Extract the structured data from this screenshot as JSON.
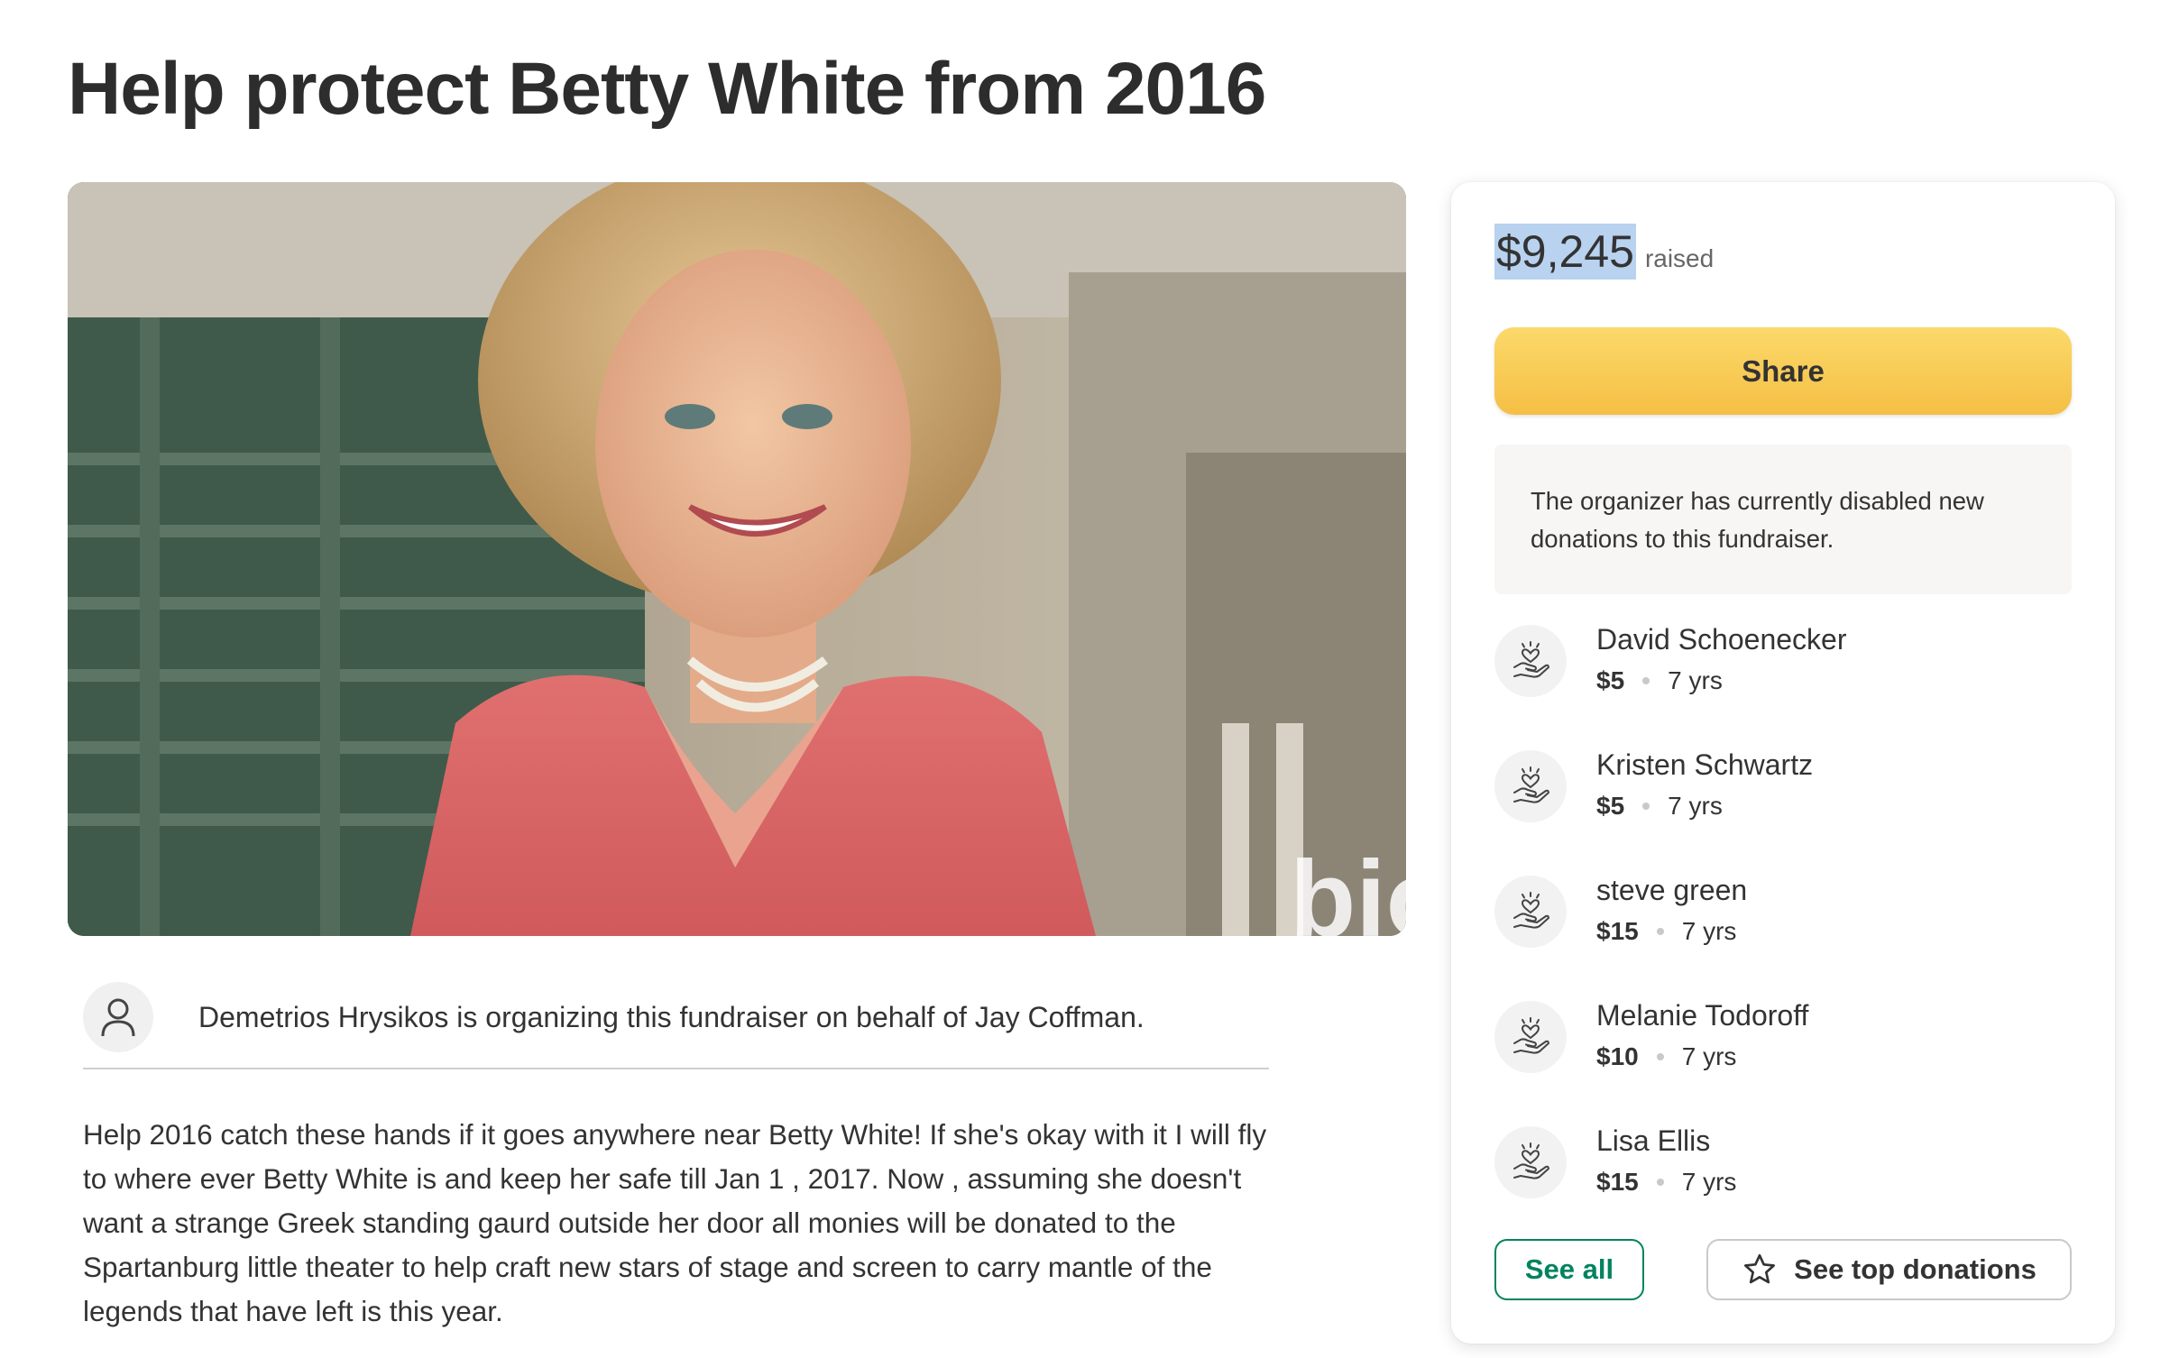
{
  "page": {
    "title": "Help protect Betty White from 2016"
  },
  "hero": {
    "watermark": "bio"
  },
  "organizer": {
    "text": "Demetrios Hrysikos is organizing this fundraiser on behalf of Jay Coffman.",
    "icon": "person-icon"
  },
  "story": {
    "text": "Help 2016 catch these hands if it goes anywhere near Betty White! If she's okay with it I will fly to where ever Betty White is and keep her safe till Jan 1 , 2017. Now , assuming she doesn't want a strange Greek standing gaurd outside her door all monies will be donated to the Spartanburg little theater to help craft new stars of stage and screen to carry mantle of the legends that have left is this year."
  },
  "sidebar": {
    "raised_amount": "$9,245",
    "raised_label": "raised",
    "share_label": "Share",
    "notice": "The organizer has currently disabled new donations to this fundraiser.",
    "donations": [
      {
        "name": "David Schoenecker",
        "amount": "$5",
        "time": "7 yrs"
      },
      {
        "name": "Kristen Schwartz",
        "amount": "$5",
        "time": "7 yrs"
      },
      {
        "name": "steve green",
        "amount": "$15",
        "time": "7 yrs"
      },
      {
        "name": "Melanie Todoroff",
        "amount": "$10",
        "time": "7 yrs"
      },
      {
        "name": "Lisa Ellis",
        "amount": "$15",
        "time": "7 yrs"
      }
    ],
    "see_all_label": "See all",
    "see_top_label": "See top donations",
    "donation_icon": "heart-hand-icon",
    "star_icon": "star-icon"
  },
  "colors": {
    "share_button": "#f5c24a",
    "accent_green": "#01835e",
    "highlight": "#b8d2ef"
  }
}
